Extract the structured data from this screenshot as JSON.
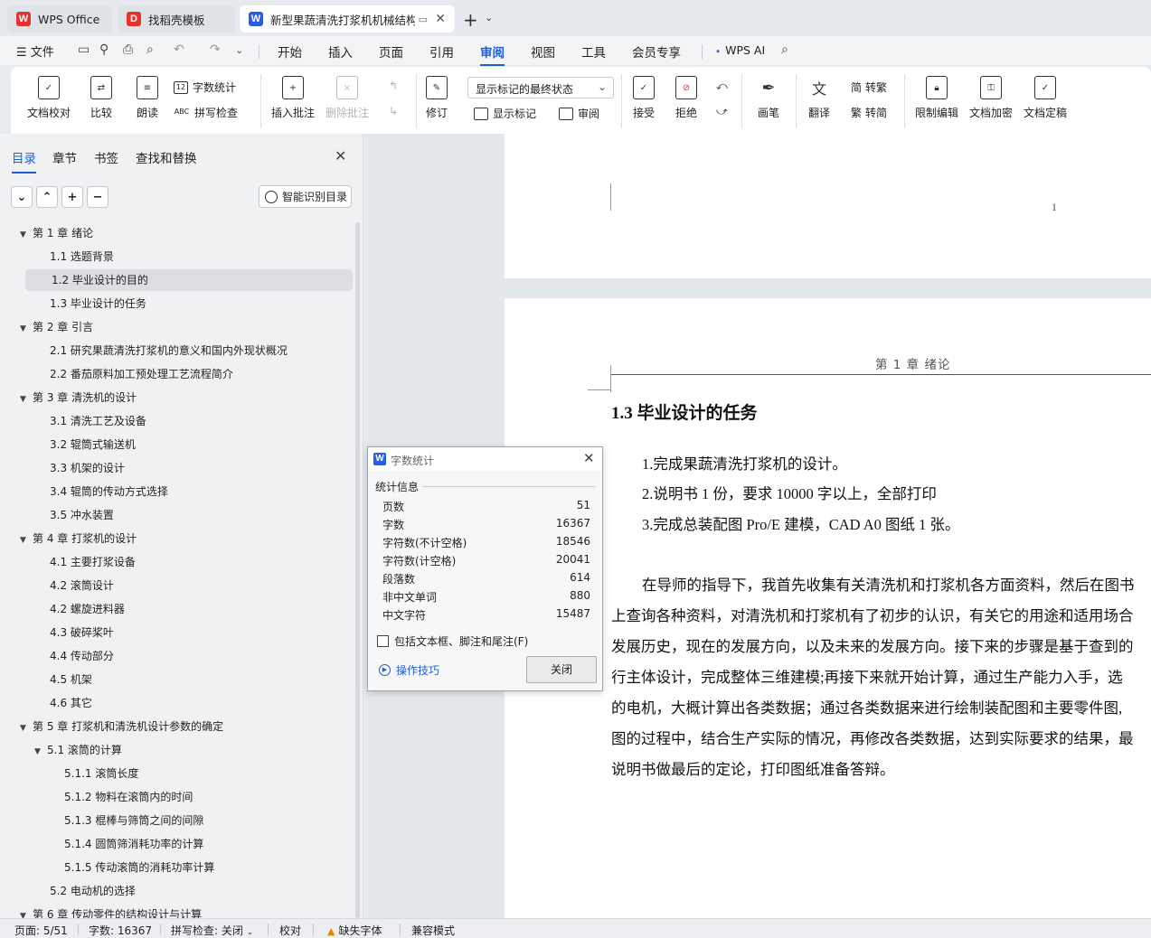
{
  "tabs": [
    {
      "label": "WPS Office",
      "icon": "wps-logo-icon",
      "color": "#e5322d"
    },
    {
      "label": "找稻壳模板",
      "icon": "docer-icon",
      "color": "#e5322d"
    },
    {
      "label": "新型果蔬清洗打浆机机械结构",
      "icon": "writer-doc-icon",
      "color": "#2b5ce6"
    }
  ],
  "menubar": {
    "file": "文件",
    "items": [
      "开始",
      "插入",
      "页面",
      "引用",
      "审阅",
      "视图",
      "工具",
      "会员专享"
    ],
    "active": "审阅",
    "wps_ai": "WPS AI"
  },
  "ribbon": {
    "doc_check": "文档校对",
    "compare": "比较",
    "read_aloud": "朗读",
    "word_count": "字数统计",
    "spell_check": "拼写检查",
    "insert_comment": "插入批注",
    "delete_comment": "删除批注",
    "track_changes": "修订",
    "markup_display": "显示标记的最终状态",
    "show_markup": "显示标记",
    "review": "审阅",
    "accept": "接受",
    "reject": "拒绝",
    "ink": "画笔",
    "translate": "翻译",
    "to_traditional": "转繁",
    "to_simplified": "转简",
    "restrict_edit": "限制编辑",
    "doc_encrypt": "文档加密",
    "doc_finalize": "文档定稿"
  },
  "nav": {
    "tabs": [
      "目录",
      "章节",
      "书签",
      "查找和替换"
    ],
    "smart_toc": "智能识别目录",
    "toc": [
      {
        "text": "第 1 章  绪论",
        "level": 1,
        "expanded": true
      },
      {
        "text": "1.1 选题背景",
        "level": 2
      },
      {
        "text": "1.2  毕业设计的目的",
        "level": 2,
        "selected": true
      },
      {
        "text": "1.3  毕业设计的任务",
        "level": 2
      },
      {
        "text": "第 2 章  引言",
        "level": 1,
        "expanded": true
      },
      {
        "text": "2.1 研究果蔬清洗打浆机的意义和国内外现状概况",
        "level": 2
      },
      {
        "text": "2.2 番茄原料加工预处理工艺流程简介",
        "level": 2
      },
      {
        "text": "第 3 章  清洗机的设计",
        "level": 1,
        "expanded": true
      },
      {
        "text": "3.1 清洗工艺及设备",
        "level": 2
      },
      {
        "text": "3.2 辊筒式输送机",
        "level": 2
      },
      {
        "text": "3.3 机架的设计",
        "level": 2
      },
      {
        "text": "3.4 辊筒的传动方式选择",
        "level": 2
      },
      {
        "text": "3.5 冲水装置",
        "level": 2
      },
      {
        "text": "第 4 章  打浆机的设计",
        "level": 1,
        "expanded": true
      },
      {
        "text": "4.1 主要打浆设备",
        "level": 2
      },
      {
        "text": "4.2 滚筒设计",
        "level": 2
      },
      {
        "text": "4.2 螺旋进料器",
        "level": 2
      },
      {
        "text": "4.3 破碎桨叶",
        "level": 2
      },
      {
        "text": "4.4 传动部分",
        "level": 2
      },
      {
        "text": "4.5 机架",
        "level": 2
      },
      {
        "text": "4.6 其它",
        "level": 2
      },
      {
        "text": "第 5 章     打浆机和清洗机设计参数的确定",
        "level": 1,
        "expanded": true
      },
      {
        "text": "5.1 滚筒的计算",
        "level": 2,
        "expanded": true
      },
      {
        "text": "5.1.1 滚筒长度",
        "level": 3
      },
      {
        "text": "5.1.2 物料在滚筒内的时间",
        "level": 3
      },
      {
        "text": "5.1.3  棍棒与筛筒之间的间隙",
        "level": 3
      },
      {
        "text": "5.1.4 圆筒筛消耗功率的计算",
        "level": 3
      },
      {
        "text": "5.1.5 传动滚筒的消耗功率计算",
        "level": 3
      },
      {
        "text": "5.2 电动机的选择",
        "level": 2
      },
      {
        "text": "第 6 章  传动零件的结构设计与计算",
        "level": 1,
        "expanded": true
      }
    ]
  },
  "document": {
    "page_number": "1",
    "header": "第 1 章  绪论",
    "heading": "1.3  毕业设计的任务",
    "paragraphs": [
      "1.完成果蔬清洗打浆机的设计。",
      "2.说明书 1 份，要求 10000 字以上，全部打印",
      "3.完成总装配图 Pro/E 建模，CAD A0 图纸 1 张。",
      "在导师的指导下，我首先收集有关清洗机和打浆机各方面资料，然后在图书",
      "上查询各种资料，对清洗机和打浆机有了初步的认识，有关它的用途和适用场合",
      "发展历史，现在的发展方向，以及未来的发展方向。接下来的步骤是基于查到的",
      "行主体设计，完成整体三维建模;再接下来就开始计算，通过生产能力入手，选",
      "的电机，大概计算出各类数据；通过各类数据来进行绘制装配图和主要零件图,",
      "图的过程中，结合生产实际的情况，再修改各类数据，达到实际要求的结果，最",
      "说明书做最后的定论，打印图纸准备答辩。"
    ]
  },
  "dialog": {
    "title": "字数统计",
    "section": "统计信息",
    "rows": [
      {
        "label": "页数",
        "value": "51"
      },
      {
        "label": "字数",
        "value": "16367"
      },
      {
        "label": "字符数(不计空格)",
        "value": "18546"
      },
      {
        "label": "字符数(计空格)",
        "value": "20041"
      },
      {
        "label": "段落数",
        "value": "614"
      },
      {
        "label": "非中文单词",
        "value": "880"
      },
      {
        "label": "中文字符",
        "value": "15487"
      }
    ],
    "include_label": "包括文本框、脚注和尾注(F)",
    "include_checked": false,
    "tips": "操作技巧",
    "close": "关闭"
  },
  "statusbar": {
    "page": "页面: 5/51",
    "words": "字数: 16367",
    "spell": "拼写检查: 关闭",
    "proof": "校对",
    "missing_font": "缺失字体",
    "compat": "兼容模式"
  },
  "colors": {
    "accent": "#1f5fd6",
    "wps_red": "#e5322d",
    "doc_bg": "#e3e9ea"
  }
}
